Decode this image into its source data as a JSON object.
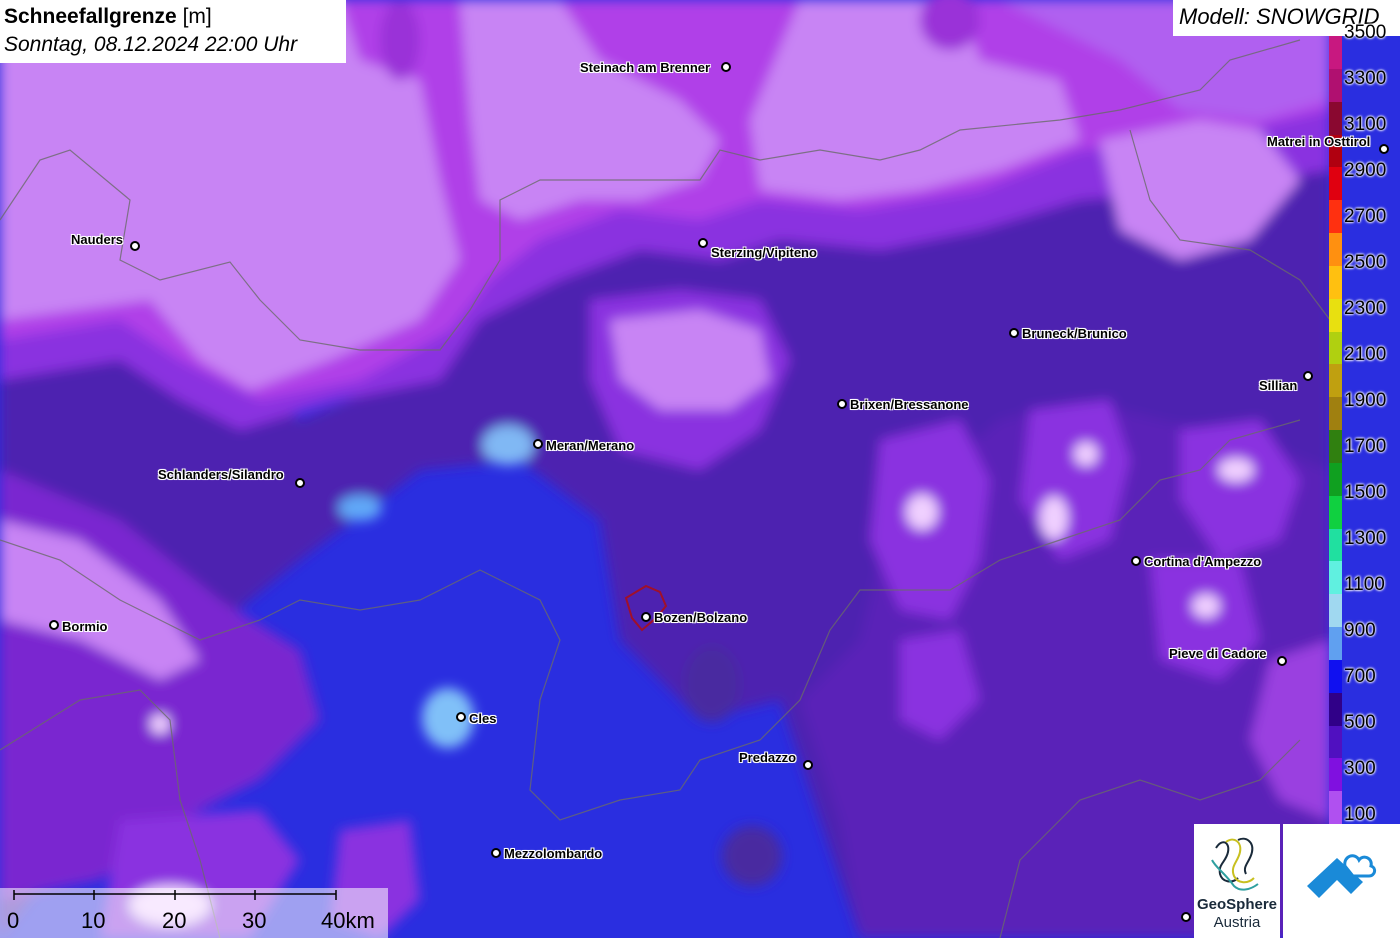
{
  "title": {
    "main_bold": "Schneefallgrenze",
    "main_unit": " [m]",
    "subtitle": "Sonntag, 08.12.2024 22:00 Uhr"
  },
  "model": "Modell: SNOWGRID",
  "legend": {
    "labels": [
      "3500",
      "3300",
      "3100",
      "2900",
      "2700",
      "2500",
      "2300",
      "2100",
      "1900",
      "1700",
      "1500",
      "1300",
      "1100",
      "900",
      "700",
      "500",
      "300",
      "100"
    ],
    "colors": [
      "#c81880",
      "#b01070",
      "#8a0830",
      "#b00010",
      "#e00010",
      "#ff3010",
      "#ff9010",
      "#ffc010",
      "#e8e010",
      "#b0d010",
      "#c0a010",
      "#a08010",
      "#308010",
      "#10a020",
      "#10d040",
      "#20e0a0",
      "#60f0e0",
      "#a0d8f0",
      "#60a0f0",
      "#1010f0",
      "#300088",
      "#5010c0",
      "#8010e0",
      "#b050f0"
    ]
  },
  "cities": [
    {
      "name": "Steinach am Brenner"
    },
    {
      "name": "Matrei in Osttirol"
    },
    {
      "name": "Nauders"
    },
    {
      "name": "Sterzing/Vipiteno"
    },
    {
      "name": "Bruneck/Brunico"
    },
    {
      "name": "Sillian"
    },
    {
      "name": "Brixen/Bressanone"
    },
    {
      "name": "Meran/Merano"
    },
    {
      "name": "Schlanders/Silandro"
    },
    {
      "name": "Cortina d'Ampezzo"
    },
    {
      "name": "Bormio"
    },
    {
      "name": "Bozen/Bolzano"
    },
    {
      "name": "Pieve di Cadore"
    },
    {
      "name": "Cles"
    },
    {
      "name": "Predazzo"
    },
    {
      "name": "Mezzolombardo"
    }
  ],
  "scale": {
    "labels": [
      "0",
      "10",
      "20",
      "30",
      "40km"
    ]
  },
  "logos": {
    "geosphere_line1": "GeoSphere",
    "geosphere_line2": "Austria"
  },
  "colors": {
    "high_snowline": "#c77cf0",
    "mid_snowline": "#8a2ee0",
    "low_snowline": "#2a2ad8",
    "very_low": "#4a2aa0"
  }
}
